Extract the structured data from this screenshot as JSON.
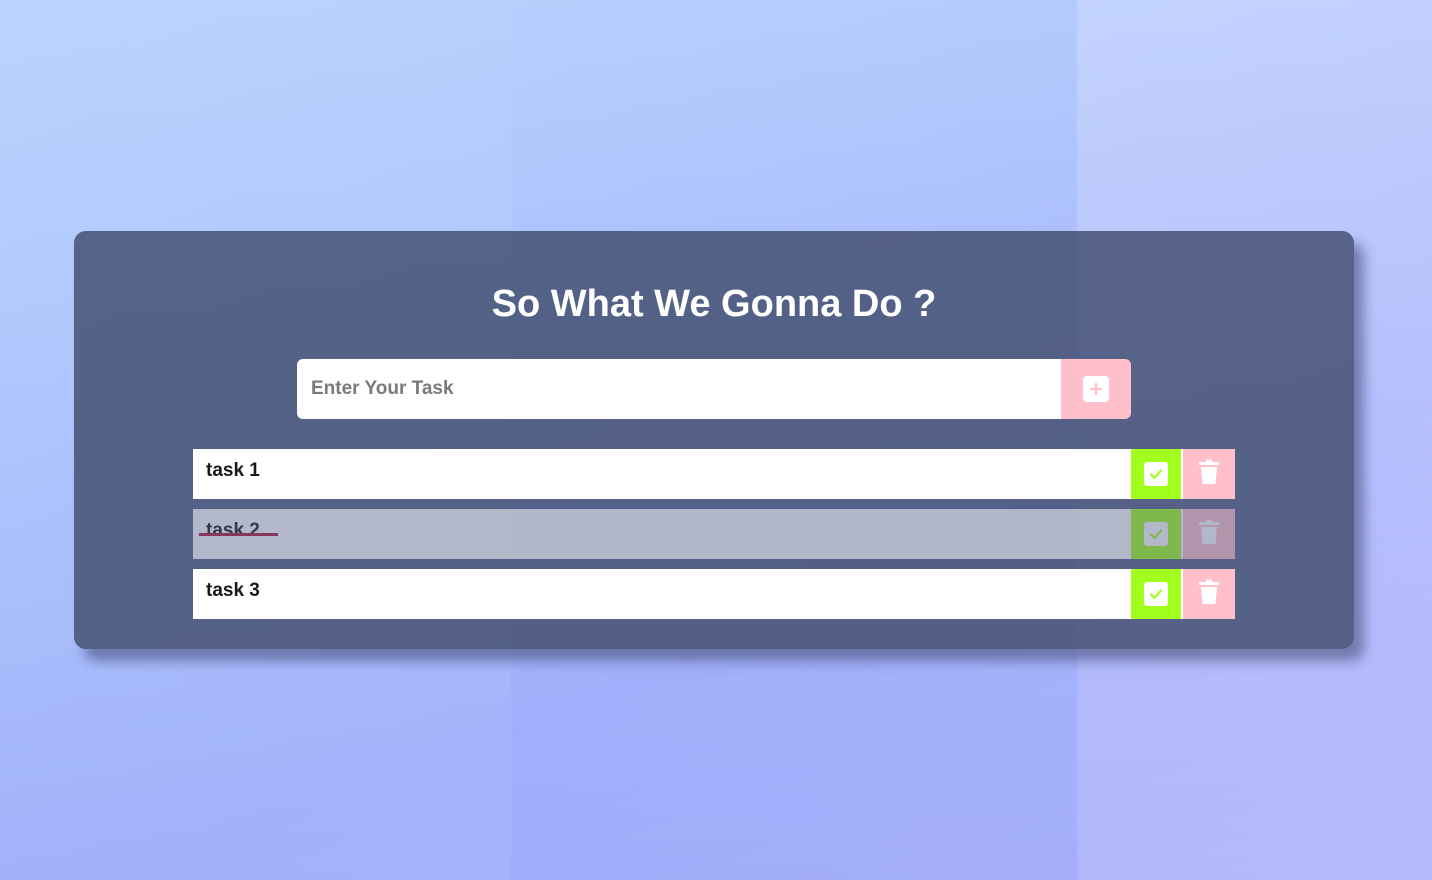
{
  "app": {
    "heading": "So What We Gonna Do ?"
  },
  "new_task": {
    "placeholder": "Enter Your Task",
    "value": "",
    "add_icon": "plus-icon"
  },
  "tasks": [
    {
      "text": "task 1",
      "completed": false
    },
    {
      "text": "task 2",
      "completed": true
    },
    {
      "text": "task 3",
      "completed": false
    }
  ],
  "icons": {
    "complete": "check-icon",
    "delete": "trash-icon"
  },
  "colors": {
    "panel": "#465273",
    "check_button": "#a2ff1d",
    "delete_button": "#ffc0cb",
    "add_button": "#ffc0cb",
    "strike": "#b3143a"
  }
}
